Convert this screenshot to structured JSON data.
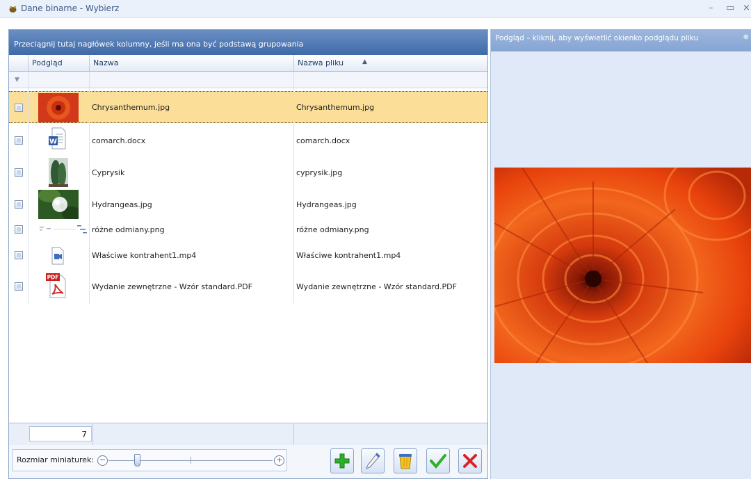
{
  "window": {
    "title": "Dane binarne - Wybierz",
    "minimize": "–",
    "maximize": "▭",
    "close": "×"
  },
  "grid": {
    "group_hint": "Przeciągnij tutaj nagłówek kolumny, jeśli ma ona być podstawą grupowania",
    "columns": {
      "preview": "Podgląd",
      "name": "Nazwa",
      "filename": "Nazwa pliku"
    },
    "sort_indicator": "▲",
    "rows": [
      {
        "name": "Chrysanthemum.jpg",
        "filename": "Chrysanthemum.jpg",
        "thumb": "flower-photo",
        "selected": true
      },
      {
        "name": "comarch.docx",
        "filename": "comarch.docx",
        "thumb": "word-document-icon",
        "selected": false
      },
      {
        "name": "Cyprysik",
        "filename": "cyprysik.jpg",
        "thumb": "cypress-photo",
        "selected": false
      },
      {
        "name": "Hydrangeas.jpg",
        "filename": "Hydrangeas.jpg",
        "thumb": "hydrangea-photo",
        "selected": false
      },
      {
        "name": "różne odmiany.png",
        "filename": "różne odmiany.png",
        "thumb": "diagram-thumbnail",
        "selected": false
      },
      {
        "name": "Właściwe kontrahent1.mp4",
        "filename": "Właściwe kontrahent1.mp4",
        "thumb": "video-file-icon",
        "selected": false
      },
      {
        "name": "Wydanie zewnętrzne - Wzór standard.PDF",
        "filename": "Wydanie zewnętrzne - Wzór standard.PDF",
        "thumb": "pdf-file-icon",
        "selected": false
      }
    ],
    "count": "7",
    "thumb_size_label": "Rozmiar miniaturek:",
    "pdf_badge": "PDF",
    "word_badge": "W"
  },
  "preview": {
    "header": "Podgląd – kliknij, aby wyświetlić okienko podglądu pliku"
  },
  "actions": [
    {
      "name": "add-button",
      "icon": "plus-icon"
    },
    {
      "name": "edit-button",
      "icon": "pencil-icon"
    },
    {
      "name": "delete-button",
      "icon": "trash-icon"
    },
    {
      "name": "confirm-button",
      "icon": "checkmark-icon"
    },
    {
      "name": "cancel-button",
      "icon": "x-icon"
    }
  ],
  "colors": {
    "selected_row": "#fbde98",
    "header_blue": "#3f6aa8",
    "flower_orange": "#e8420c",
    "add_green": "#2fae2a",
    "cancel_red": "#d9232a"
  }
}
